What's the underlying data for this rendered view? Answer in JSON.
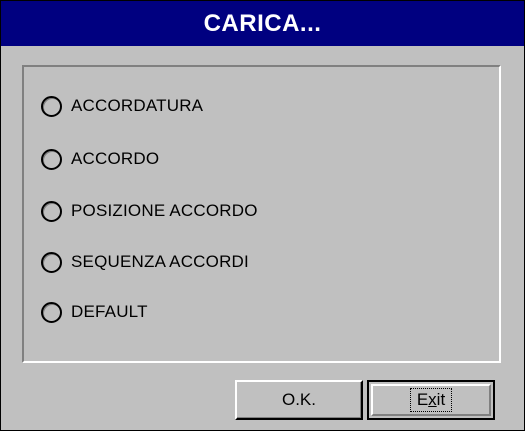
{
  "dialog": {
    "title": "CARICA...",
    "options": [
      {
        "label": "ACCORDATURA",
        "selected": false
      },
      {
        "label": "ACCORDO",
        "selected": false
      },
      {
        "label": "POSIZIONE ACCORDO",
        "selected": false
      },
      {
        "label": "SEQUENZA ACCORDI",
        "selected": false
      },
      {
        "label": "DEFAULT",
        "selected": false
      }
    ],
    "buttons": {
      "ok_label": "O.K.",
      "exit_pre": "E",
      "exit_mnemonic": "x",
      "exit_post": "it"
    }
  },
  "colors": {
    "titlebar": "#000080",
    "face": "#c0c0c0"
  }
}
